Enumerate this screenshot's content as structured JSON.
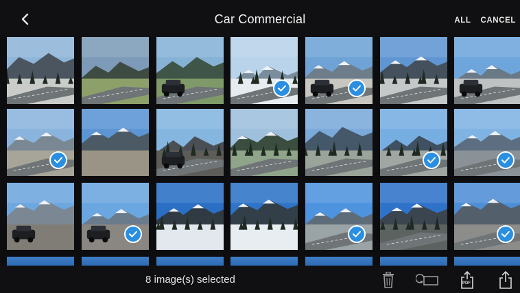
{
  "header": {
    "title": "Car Commercial",
    "all_label": "ALL",
    "cancel_label": "CANCEL",
    "back_icon": "chevron-left-icon"
  },
  "gallery": {
    "rows": [
      [
        {
          "scene": "forest-road",
          "selected": false
        },
        {
          "scene": "mountain-field",
          "selected": false
        },
        {
          "scene": "lake-road",
          "selected": false
        },
        {
          "scene": "snow-road",
          "selected": true
        },
        {
          "scene": "village-car",
          "selected": true
        },
        {
          "scene": "village-lake",
          "selected": false
        },
        {
          "scene": "village-car2",
          "selected": false
        }
      ],
      [
        {
          "scene": "snow-mountain",
          "selected": true
        },
        {
          "scene": "lake-houses",
          "selected": false
        },
        {
          "scene": "car-person",
          "selected": false
        },
        {
          "scene": "green-road",
          "selected": false
        },
        {
          "scene": "tree-road",
          "selected": false
        },
        {
          "scene": "mountain-road",
          "selected": true
        },
        {
          "scene": "mountain-curve",
          "selected": true
        }
      ],
      [
        {
          "scene": "car-people",
          "selected": false
        },
        {
          "scene": "car-lake",
          "selected": true
        },
        {
          "scene": "blue-sky-snow",
          "selected": false
        },
        {
          "scene": "blue-sky-snow2",
          "selected": false
        },
        {
          "scene": "mountain-lake-road",
          "selected": true
        },
        {
          "scene": "sky-hills",
          "selected": false
        },
        {
          "scene": "road-mountain",
          "selected": true
        }
      ]
    ]
  },
  "footer": {
    "selection_text": "8 image(s) selected",
    "icons": [
      "trash-icon",
      "duplicate-icon",
      "export-pdf-icon",
      "share-icon"
    ],
    "pdf_label": "PDF"
  },
  "colors": {
    "accent": "#2a8fe0",
    "bar_bg": "#101012"
  }
}
